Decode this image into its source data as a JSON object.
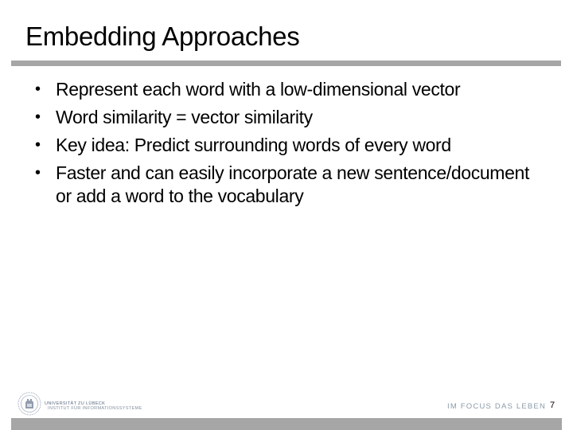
{
  "slide": {
    "title": "Embedding Approaches",
    "bullets": [
      {
        "text": "Represent each word with a low-dimensional vector"
      },
      {
        "text": "Word similarity = vector similarity"
      },
      {
        "text": "Key idea: Predict surrounding words of every word"
      },
      {
        "text": "Faster and can easily incorporate a new sentence/document or add a word to the vocabulary"
      }
    ],
    "bullet_glyph": "•"
  },
  "footer": {
    "logo_icon": "university-seal-icon",
    "university": "UNIVERSITÄT ZU LÜBECK",
    "institute": "INSTITUT FÜR INFORMATIONSSYSTEME",
    "motto": "IM FOCUS DAS LEBEN",
    "page_number": "7"
  },
  "colors": {
    "rule": "#a6a6a6",
    "motto": "#8b9ba8",
    "logo": "#5b6a80"
  }
}
